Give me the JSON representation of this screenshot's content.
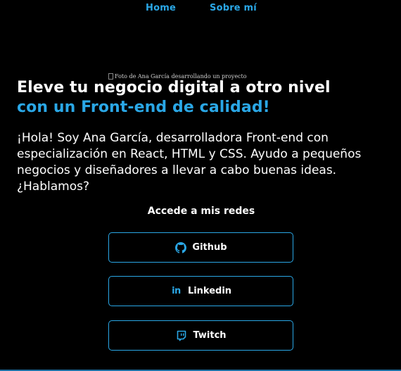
{
  "nav": {
    "home": "Home",
    "about": "Sobre mí"
  },
  "hero": {
    "image_alt": "Foto de Ana García desarrollando un proyecto",
    "title_line1": "Eleve tu negocio digital a otro nivel",
    "title_line2": "con un Front-end de calidad!",
    "intro": "¡Hola! Soy Ana García, desarrolladora Front-end con especialización en React, HTML y CSS. Ayudo a pequeños negocios y diseñadores a llevar a cabo buenas ideas. ¿Hablamos?"
  },
  "social": {
    "title": "Accede a mis redes",
    "buttons": [
      {
        "label": "Github",
        "icon": "github-icon"
      },
      {
        "label": "Linkedin",
        "icon": "linkedin-icon"
      },
      {
        "label": "Twitch",
        "icon": "twitch-icon"
      }
    ]
  },
  "colors": {
    "background": "#000000",
    "accent": "#2aa7e6",
    "text": "#ffffff"
  }
}
